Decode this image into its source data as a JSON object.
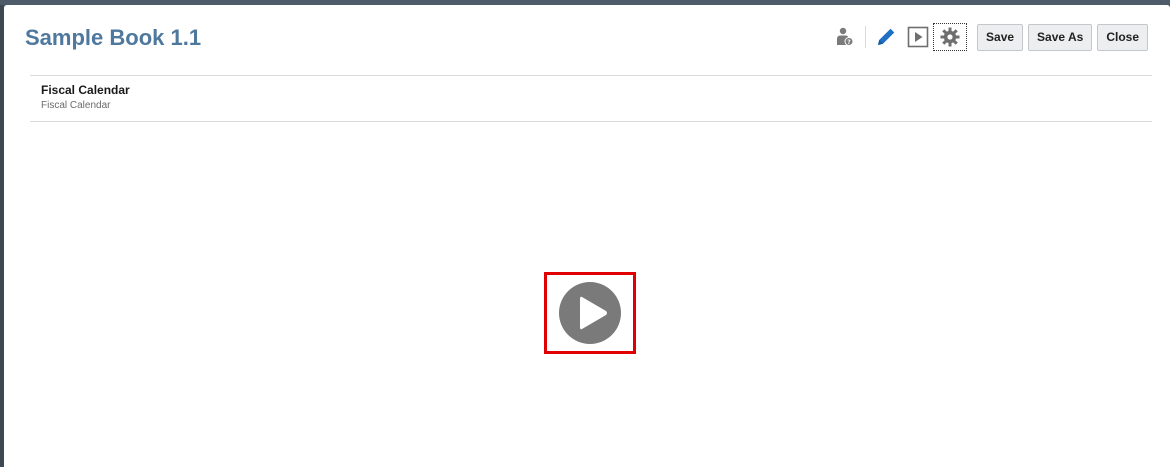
{
  "header": {
    "title": "Sample Book 1.1"
  },
  "toolbar": {
    "icons": {
      "inspector": "user-info-icon",
      "edit": "pencil-icon",
      "run": "play-square-icon",
      "settings": "gear-icon"
    },
    "save_label": "Save",
    "save_as_label": "Save As",
    "close_label": "Close"
  },
  "content": {
    "item_name": "Fiscal Calendar",
    "item_description": "Fiscal Calendar"
  },
  "player": {
    "icon": "play-circle-icon"
  },
  "colors": {
    "title": "#4f789e",
    "accent_blue": "#1f6fc5",
    "highlight_red": "#e00000",
    "icon_gray": "#7a7a7a"
  }
}
